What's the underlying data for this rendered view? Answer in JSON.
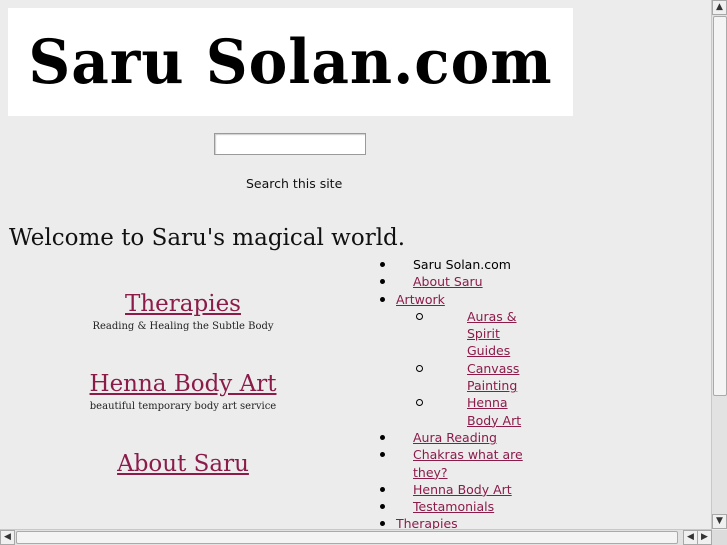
{
  "site": {
    "logo_text": "Saru Solan.com"
  },
  "search": {
    "value": "",
    "label": "Search this site"
  },
  "welcome": "Welcome to Saru's magical world.",
  "features": [
    {
      "title": "Therapies",
      "desc": "Reading & Healing the Subtle Body"
    },
    {
      "title": "Henna Body Art",
      "desc": "beautiful temporary body art service"
    },
    {
      "title": "About Saru",
      "desc": ""
    }
  ],
  "menu": {
    "home": "Saru Solan.com",
    "about": "About Saru",
    "artwork": "Artwork",
    "artwork_children": [
      "Auras & Spirit Guides",
      "Canvass Painting",
      "Henna Body Art"
    ],
    "aura_reading": "Aura Reading",
    "chakras": "Chakras what are they?",
    "henna": "Henna Body Art",
    "testimonials": "Testamonials",
    "therapies": "Therapies"
  },
  "icons": {
    "scroll_up": "arrow-up-icon",
    "scroll_down": "arrow-down-icon",
    "scroll_left": "arrow-left-icon",
    "scroll_right": "arrow-right-icon"
  }
}
